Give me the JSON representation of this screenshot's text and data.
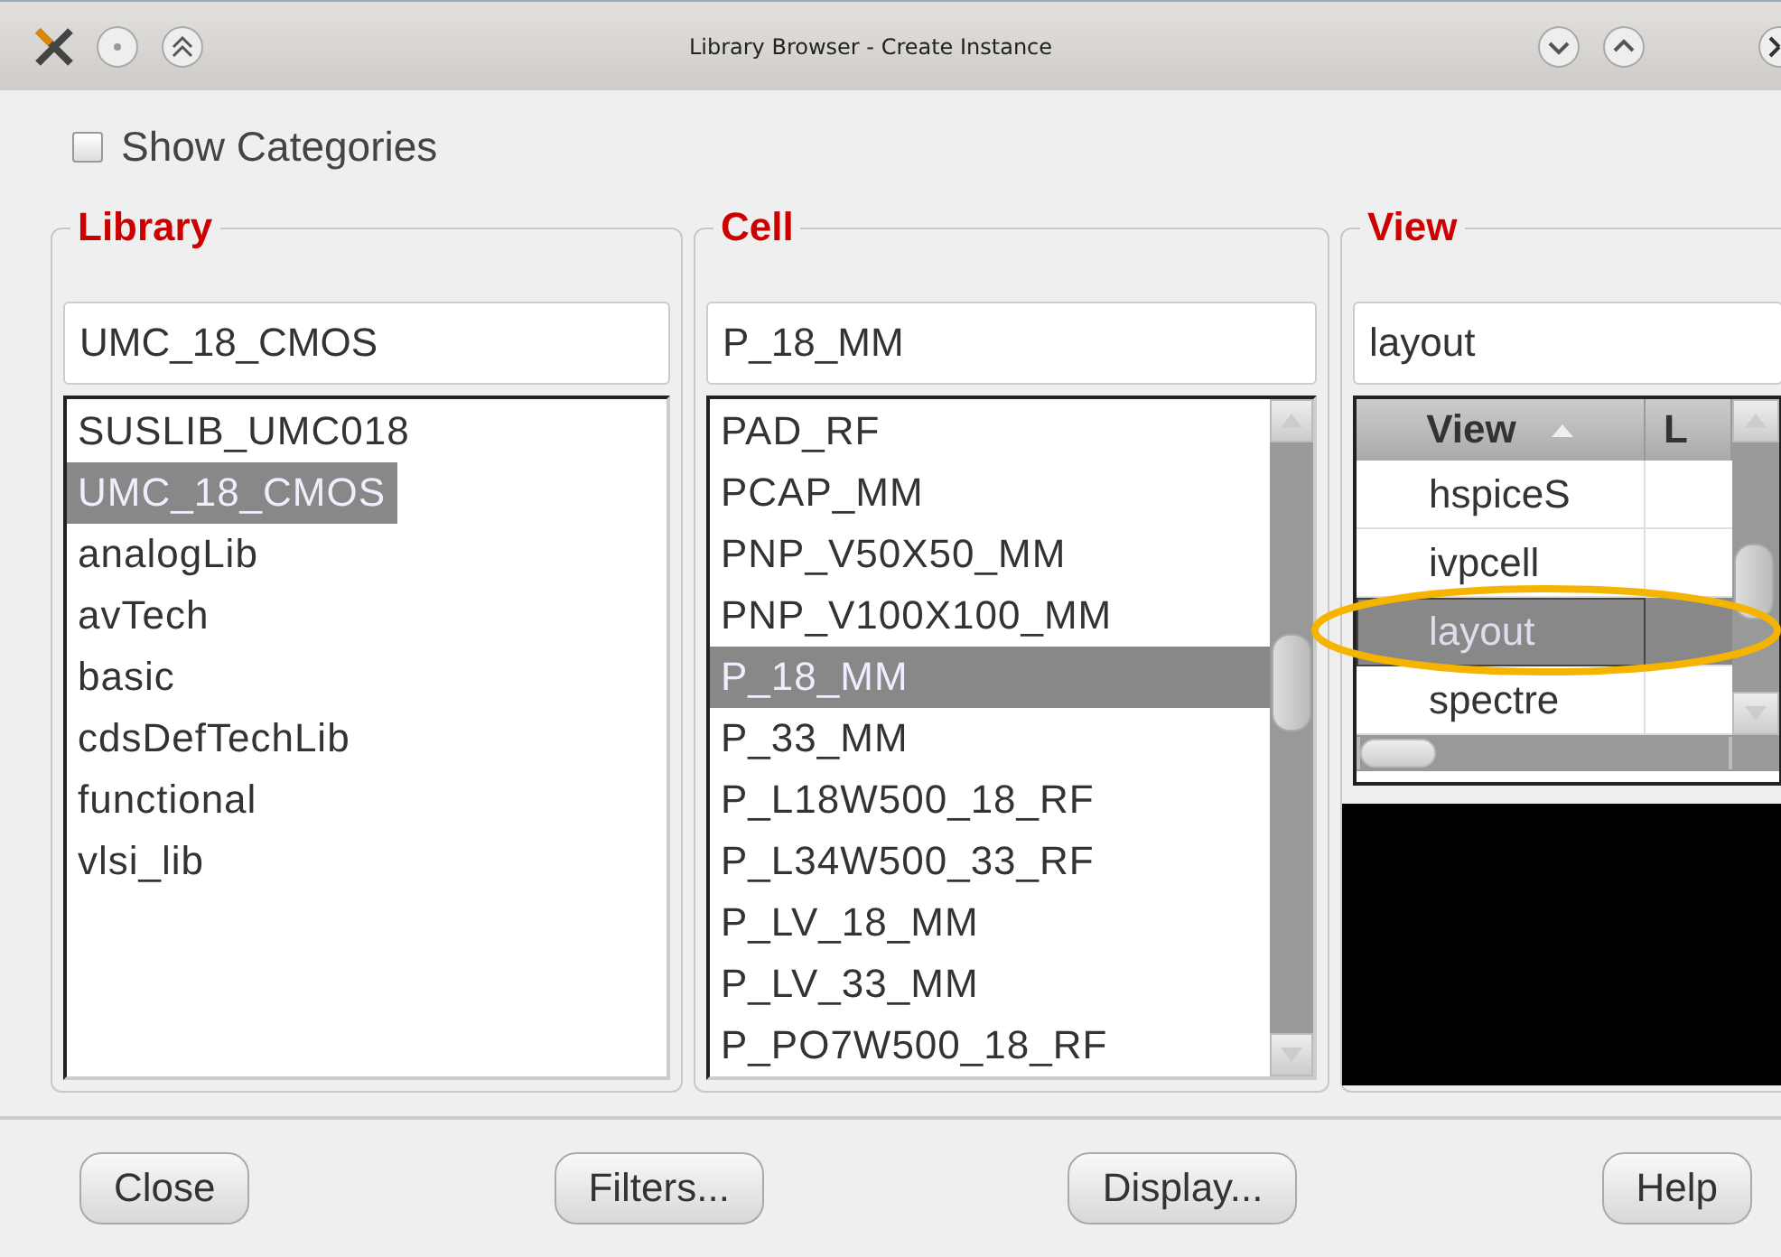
{
  "window": {
    "title": "Library Browser - Create Instance"
  },
  "show_categories": {
    "label": "Show Categories",
    "checked": false
  },
  "library": {
    "title": "Library",
    "value": "UMC_18_CMOS",
    "items": [
      {
        "label": "SUSLIB_UMC018",
        "selected": false
      },
      {
        "label": "UMC_18_CMOS",
        "selected": true
      },
      {
        "label": "analogLib",
        "selected": false
      },
      {
        "label": "avTech",
        "selected": false
      },
      {
        "label": "basic",
        "selected": false
      },
      {
        "label": "cdsDefTechLib",
        "selected": false
      },
      {
        "label": "functional",
        "selected": false
      },
      {
        "label": "vlsi_lib",
        "selected": false
      }
    ]
  },
  "cell": {
    "title": "Cell",
    "value": "P_18_MM",
    "items": [
      {
        "label": "PAD_RF",
        "selected": false
      },
      {
        "label": "PCAP_MM",
        "selected": false
      },
      {
        "label": "PNP_V50X50_MM",
        "selected": false
      },
      {
        "label": "PNP_V100X100_MM",
        "selected": false
      },
      {
        "label": "P_18_MM",
        "selected": true
      },
      {
        "label": "P_33_MM",
        "selected": false
      },
      {
        "label": "P_L18W500_18_RF",
        "selected": false
      },
      {
        "label": "P_L34W500_33_RF",
        "selected": false
      },
      {
        "label": "P_LV_18_MM",
        "selected": false
      },
      {
        "label": "P_LV_33_MM",
        "selected": false
      },
      {
        "label": "P_PO7W500_18_RF",
        "selected": false
      }
    ]
  },
  "view": {
    "title": "View",
    "value": "layout",
    "columns": [
      "View",
      "L"
    ],
    "items": [
      {
        "label": "hspiceS",
        "selected": false
      },
      {
        "label": "ivpcell",
        "selected": false
      },
      {
        "label": "layout",
        "selected": true
      },
      {
        "label": "spectre",
        "selected": false
      }
    ]
  },
  "buttons": [
    "Close",
    "Filters...",
    "Display...",
    "Help"
  ]
}
